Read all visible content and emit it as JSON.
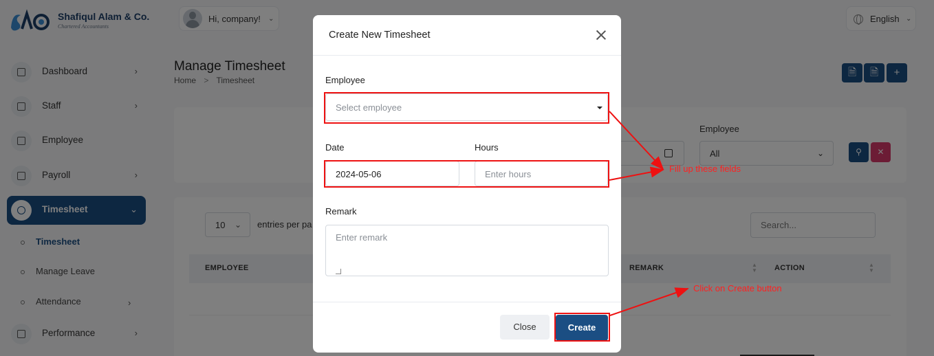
{
  "brand": {
    "name": "Shafiqul Alam & Co.",
    "tagline": "Chartered Accountants"
  },
  "header": {
    "greeting": "Hi, company!",
    "language": "English"
  },
  "sidebar": {
    "items": [
      {
        "label": "Dashboard"
      },
      {
        "label": "Staff"
      },
      {
        "label": "Employee"
      },
      {
        "label": "Payroll"
      },
      {
        "label": "Timesheet"
      },
      {
        "label": "Performance"
      }
    ],
    "subitems": [
      {
        "label": "Timesheet"
      },
      {
        "label": "Manage Leave"
      },
      {
        "label": "Attendance"
      }
    ]
  },
  "page": {
    "title": "Manage Timesheet",
    "breadcrumb": {
      "home": "Home",
      "separator": ">",
      "current": "Timesheet"
    }
  },
  "filters": {
    "employee_label": "Employee",
    "employee_value": "All"
  },
  "table": {
    "length_value": "10",
    "length_text": "entries per pa",
    "search_placeholder": "Search...",
    "headers": {
      "employee": "EMPLOYEE",
      "remark": "REMARK",
      "action": "ACTION"
    }
  },
  "modal": {
    "title": "Create New Timesheet",
    "employee_label": "Employee",
    "employee_placeholder": "Select employee",
    "date_label": "Date",
    "date_value": "2024-05-06",
    "hours_label": "Hours",
    "hours_placeholder": "Enter hours",
    "remark_label": "Remark",
    "remark_placeholder": "Enter remark",
    "close_label": "Close",
    "create_label": "Create"
  },
  "annotations": {
    "fill_note": "Fill up these fields",
    "create_note": "Click on Create button",
    "color": "#ee1111"
  },
  "colors": {
    "primary": "#1b4e83",
    "danger": "#d9386a",
    "overlay": "rgba(0,0,0,0.5)"
  },
  "icons": {
    "header_buttons": [
      "export-file-icon",
      "import-file-icon",
      "plus-icon"
    ],
    "filter_buttons": [
      "search-icon",
      "clear-filter-icon"
    ]
  }
}
